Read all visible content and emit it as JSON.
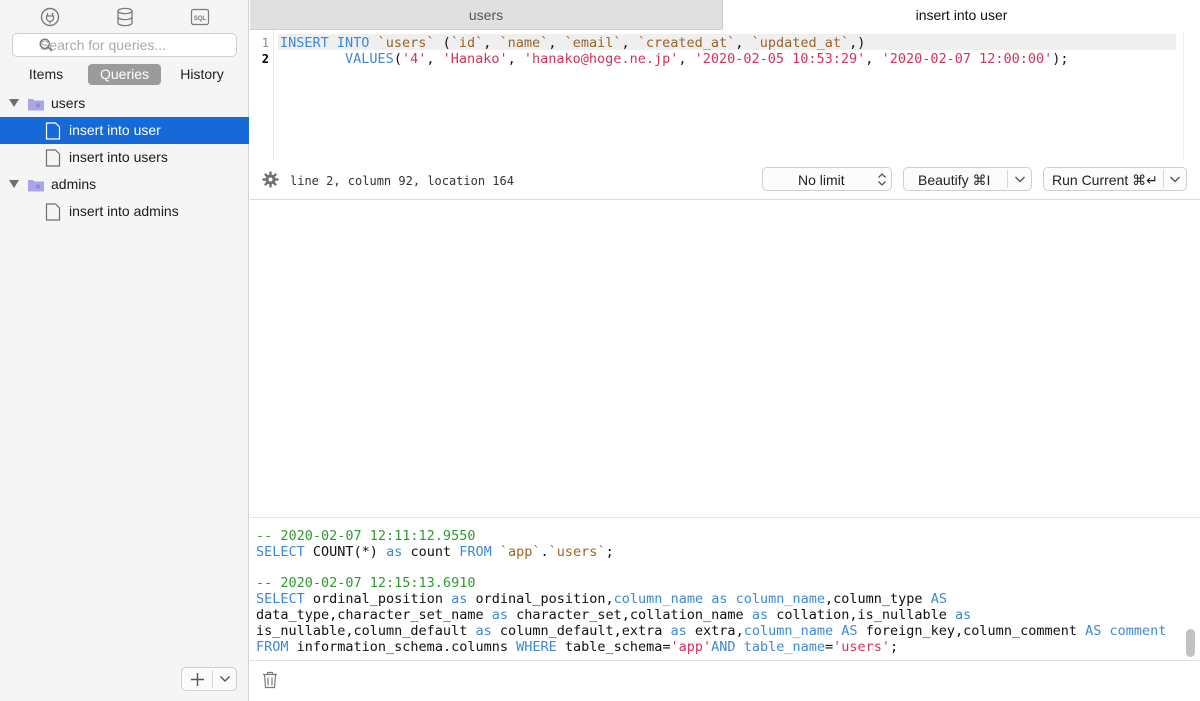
{
  "sidebar": {
    "top_icons": [
      "plug-icon",
      "database-icon",
      "sql-icon"
    ],
    "search_placeholder": "Search for queries...",
    "segments": [
      "Items",
      "Queries",
      "History"
    ],
    "active_segment": "Queries",
    "tree": [
      {
        "type": "folder",
        "label": "users"
      },
      {
        "type": "query",
        "label": "insert into user",
        "selected": true
      },
      {
        "type": "query",
        "label": "insert into users"
      },
      {
        "type": "folder",
        "label": "admins"
      },
      {
        "type": "query",
        "label": "insert into admins"
      }
    ]
  },
  "tabs": [
    {
      "label": "users",
      "active": false
    },
    {
      "label": "insert into user",
      "active": true
    }
  ],
  "editor": {
    "line_numbers": [
      "1",
      "2"
    ],
    "line1": {
      "kw_insert": "INSERT",
      "kw_into": "INTO",
      "tbl": "`users`",
      "open": " (",
      "c1": "`id`",
      "c2": "`name`",
      "c3": "`email`",
      "c4": "`created_at`",
      "c5": "`updated_at`",
      "sep": ", ",
      "close": ",)"
    },
    "line2": {
      "kw_values": "VALUES",
      "open": "(",
      "v1": "'4'",
      "v2": "'Hanako'",
      "v3": "'hanako@hoge.ne.jp'",
      "v4": "'2020-02-05 10:53:29'",
      "v5": "'2020-02-07 12:00:00'",
      "sep": ", ",
      "close": ");"
    }
  },
  "toolbar": {
    "status": "line 2, column 92, location 164",
    "limit_label": "No limit",
    "beautify_label": "Beautify ⌘I",
    "run_label": "Run Current ⌘↵"
  },
  "log": {
    "entry1": {
      "comment": "-- 2020-02-07 12:11:12.9550",
      "kw_select": "SELECT",
      "count": " COUNT(*) ",
      "kw_as": "as",
      "alias": " count ",
      "kw_from": "FROM",
      "schema": "`app`",
      "dot": ".",
      "tbl": "`users`",
      "end": ";"
    },
    "entry2": {
      "comment": "-- 2020-02-07 12:15:13.6910",
      "l1_select": "SELECT",
      "l1_a": " ordinal_position ",
      "l1_as1": "as",
      "l1_b": " ordinal_position,",
      "l1_c": "column_name",
      "l1_sp1": " ",
      "l1_as2": "as",
      "l1_sp2": " ",
      "l1_d": "column_name",
      "l1_e": ",column_type ",
      "l1_as3": "AS",
      "l2_a": "data_type,character_set_name ",
      "l2_as1": "as",
      "l2_b": " character_set,collation_name ",
      "l2_as2": "as",
      "l2_c": " collation,is_nullable ",
      "l2_as3": "as",
      "l3_a": "is_nullable,column_default ",
      "l3_as1": "as",
      "l3_b": " column_default,extra ",
      "l3_as2": "as",
      "l3_c": " extra,",
      "l3_d": "column_name",
      "l3_sp": " ",
      "l3_as3": "AS",
      "l3_e": " foreign_key,column_comment ",
      "l3_as4": "AS",
      "l3_sp2": " ",
      "l3_f": "comment",
      "l4_from": "FROM",
      "l4_a": " information_schema.columns ",
      "l4_where": "WHERE",
      "l4_b": " table_schema=",
      "l4_s1": "'app'",
      "l4_and": "AND",
      "l4_sp": " ",
      "l4_c": "table_name",
      "l4_eq": "=",
      "l4_s2": "'users'",
      "l4_end": ";"
    }
  },
  "colors": {
    "selection": "#1769d7",
    "keyword": "#3d88d6",
    "identifier": "#9a6428",
    "string": "#d9305a",
    "comment": "#2f9b2f"
  }
}
